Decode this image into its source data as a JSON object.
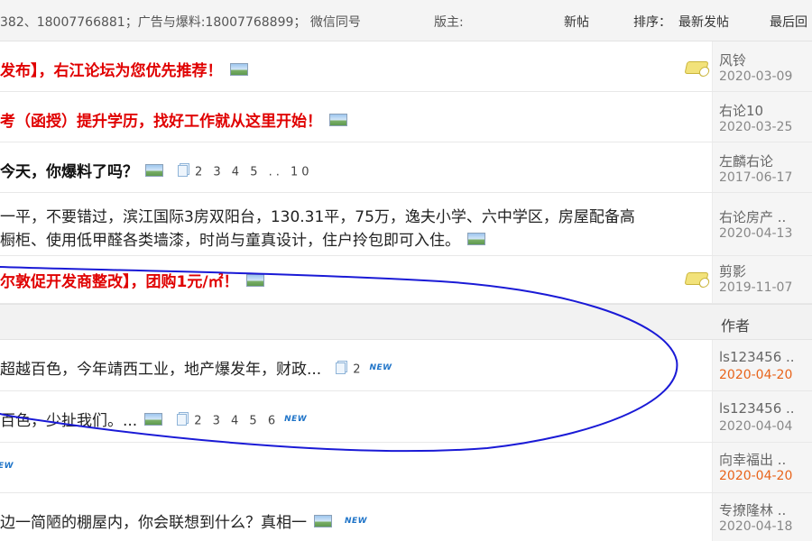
{
  "topbar": {
    "contact": "382、18007766881；广告与爆料:18007768899； 微信同号",
    "moderator": "版主:",
    "new_post": "新帖",
    "sort_label": "排序：",
    "sort_value": "最新发帖",
    "last_reply": "最后回"
  },
  "sticky_threads": [
    {
      "title": "发布】，右江论坛为您优先推荐！",
      "author": "风铃",
      "date": "2020-03-09"
    },
    {
      "title": "考（函授）提升学历，找好工作就从这里开始！",
      "author": "右论10",
      "date": "2020-03-25"
    },
    {
      "title": "今天，你爆料了吗？",
      "pages": "2 3 4 5 .. 10",
      "author": "左麟右论",
      "date": "2017-06-17"
    },
    {
      "title_line1": "一平，不要错过，滨江国际3房双阳台，130.31平，75万，逸夫小学、六中学区，房屋配备高",
      "title_line2": "橱柜、使用低甲醛各类墙漆，时尚与童真设计，住户拎包即可入住。",
      "author": "右论房产 ..",
      "date": "2020-04-13"
    },
    {
      "title": "尔敦促开发商整改】，团购1元/㎡！",
      "author": "剪影",
      "date": "2019-11-07"
    }
  ],
  "section": {
    "author_header": "作者"
  },
  "threads": [
    {
      "title": "超越百色，今年靖西工业，地产爆发年，财政...",
      "pages": "2",
      "badge": "NEW",
      "author": "ls123456 ..",
      "date": "2020-04-20"
    },
    {
      "title": "百色，少扯我们。...",
      "pages": "2 3 4 5 6",
      "badge": "NEW",
      "author": "ls123456 ..",
      "date": "2020-04-04"
    },
    {
      "badge": "EW",
      "author": "向幸福出 ..",
      "date": "2020-04-20"
    },
    {
      "title": "边一简陋的棚屋内，你会联想到什么？真相一",
      "badge": "NEW",
      "author": "专撩隆林 ..",
      "date": "2020-04-18"
    }
  ],
  "colors": {
    "title_red": "#e00000",
    "hot_date": "#e8641b",
    "annotation_stroke": "#1a1ad6",
    "new_badge": "#1f74c8"
  }
}
